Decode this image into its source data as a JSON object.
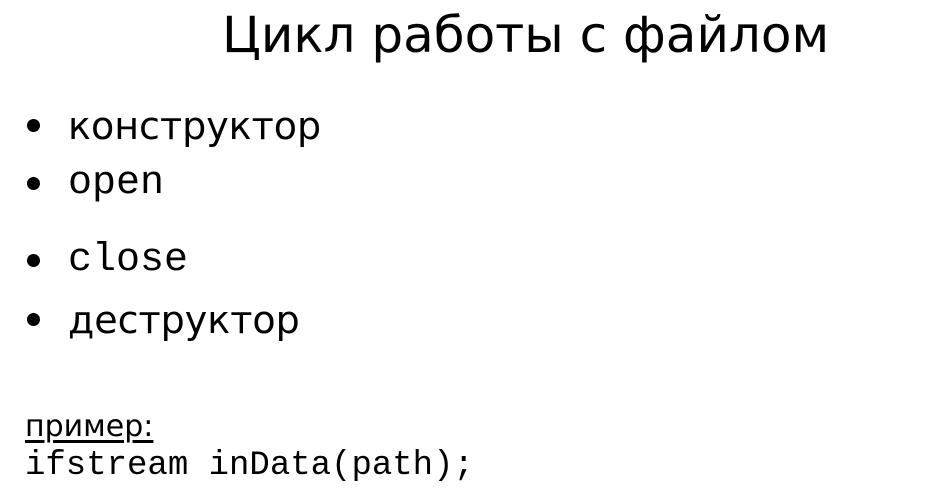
{
  "slide": {
    "title": "Цикл работы с файлом",
    "bullets": [
      {
        "text": "конструктор",
        "style": "sans"
      },
      {
        "text": "open",
        "style": "mono"
      },
      {
        "text": "close",
        "style": "mono"
      },
      {
        "text": "деструктор",
        "style": "sans"
      }
    ],
    "example_label": "пример:",
    "example_code": "ifstream inData(path);"
  }
}
